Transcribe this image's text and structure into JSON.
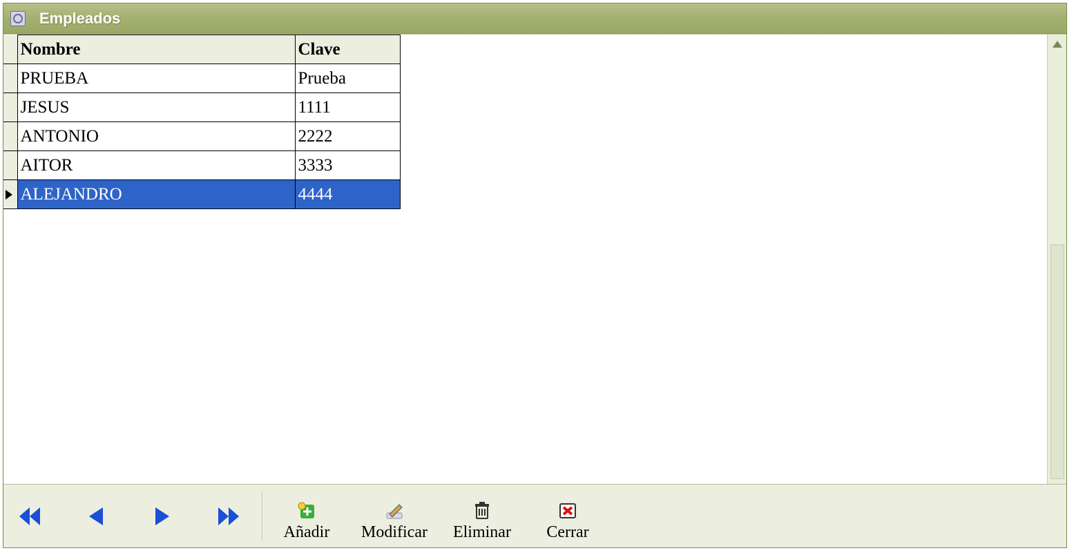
{
  "title": "Empleados",
  "columns": {
    "nombre": "Nombre",
    "clave": "Clave"
  },
  "rows": [
    {
      "nombre": "PRUEBA",
      "clave": "Prueba",
      "selected": false
    },
    {
      "nombre": "JESUS",
      "clave": "1111",
      "selected": false
    },
    {
      "nombre": "ANTONIO",
      "clave": "2222",
      "selected": false
    },
    {
      "nombre": "AITOR",
      "clave": "3333",
      "selected": false
    },
    {
      "nombre": "ALEJANDRO",
      "clave": "4444",
      "selected": true
    }
  ],
  "toolbar": {
    "add": "Añadir",
    "modify": "Modificar",
    "delete": "Eliminar",
    "close": "Cerrar"
  }
}
